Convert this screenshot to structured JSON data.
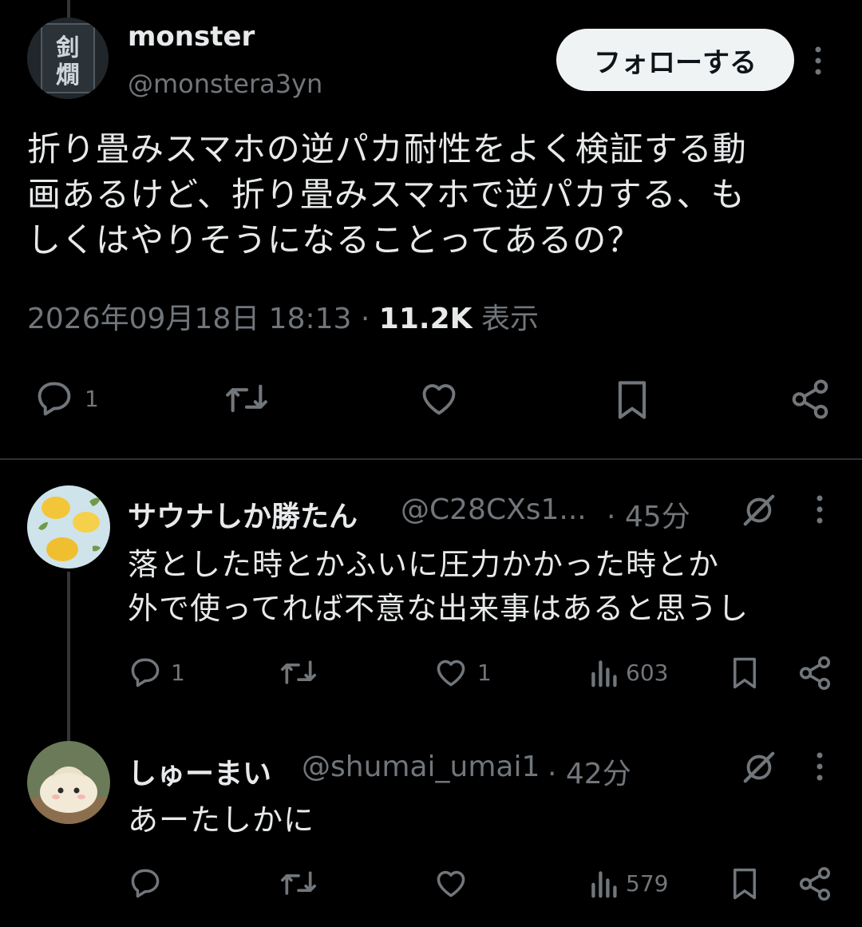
{
  "main_tweet": {
    "display_name": "monster",
    "handle": "@monstera3yn",
    "follow_label": "フォローする",
    "text_lines": [
      "折り畳みスマホの逆パカ耐性をよく検証する動",
      "画あるけど、折り畳みスマホで逆パカする、も",
      "しくはやりそうになることってあるの？"
    ],
    "timestamp": "2026年09月18日 18:13",
    "separator": "·",
    "views": "11.2K",
    "views_label": "表示",
    "reply_count": "1",
    "avatar_icon": "kanji-logo-avatar"
  },
  "replies": [
    {
      "display_name": "サウナしか勝たん",
      "handle": "@C28CXs1...",
      "time": "· 45分",
      "text_lines": [
        "落とした時とかふいに圧力かかった時とか",
        "外で使ってれば不意な出来事はあると思うし"
      ],
      "reply_count": "1",
      "like_count": "1",
      "views": "603",
      "avatar_icon": "lemon-avatar"
    },
    {
      "display_name": "しゅーまい",
      "handle": "@shumai_umai1",
      "time": "· 42分",
      "text_lines": [
        "あーたしかに"
      ],
      "reply_count": "",
      "like_count": "",
      "views": "579",
      "avatar_icon": "shumai-avatar"
    }
  ],
  "colors": {
    "background": "#000000",
    "text_primary": "#e7e9ea",
    "text_secondary": "#71767b",
    "follow_bg": "#eff3f4",
    "divider": "#2f3336"
  }
}
